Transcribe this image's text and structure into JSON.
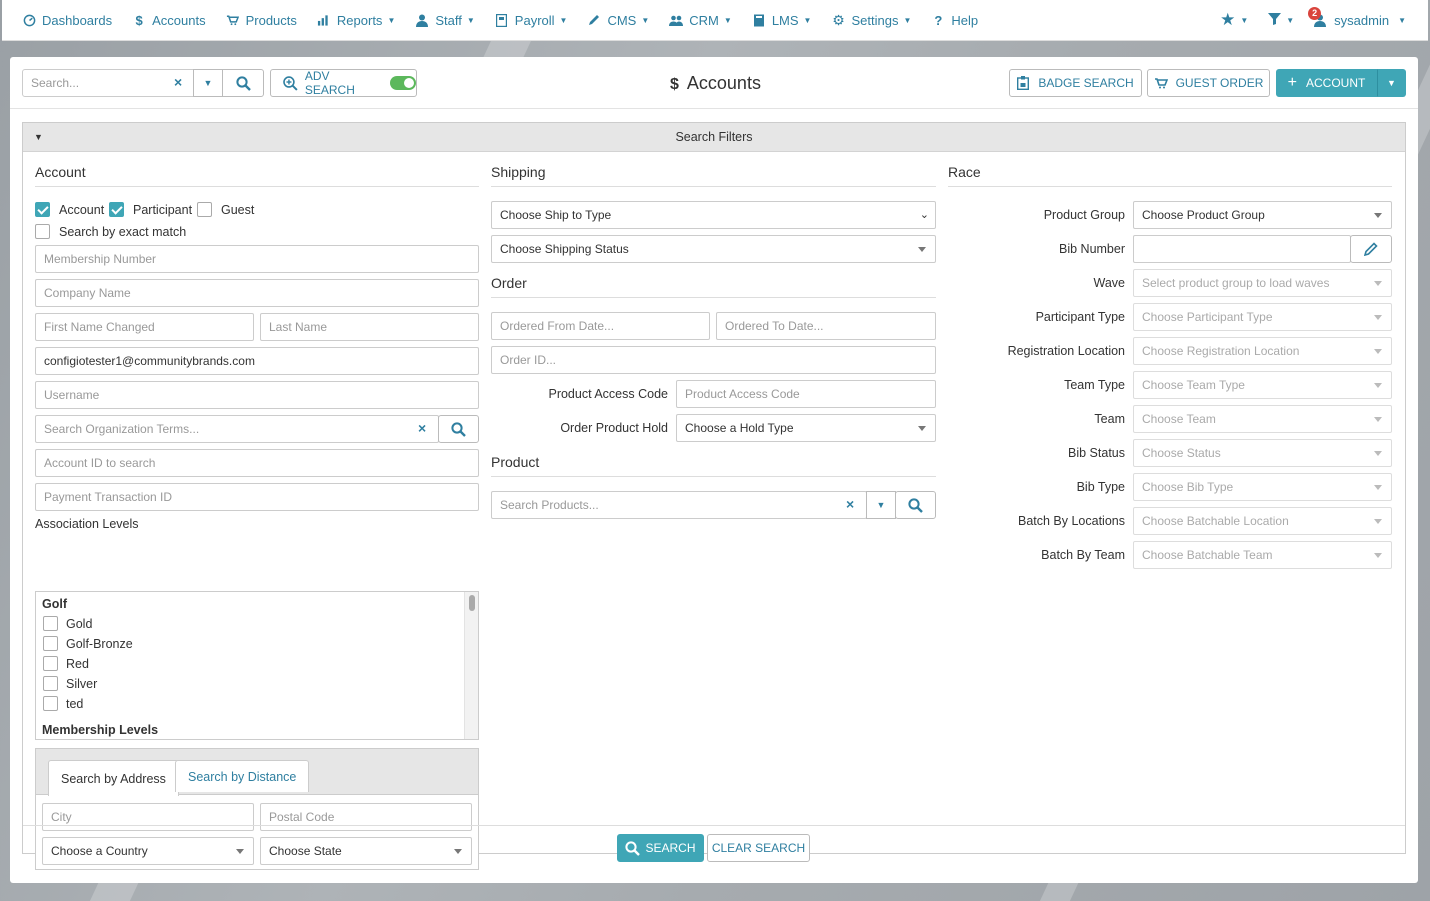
{
  "nav": {
    "items": [
      {
        "label": "Dashboards",
        "icon": "dashboard-icon"
      },
      {
        "label": "Accounts",
        "icon": "dollar-icon"
      },
      {
        "label": "Products",
        "icon": "cart-icon"
      },
      {
        "label": "Reports",
        "icon": "chart-icon"
      },
      {
        "label": "Staff",
        "icon": "person-icon"
      },
      {
        "label": "Payroll",
        "icon": "ledger-icon"
      },
      {
        "label": "CMS",
        "icon": "pencil-icon"
      },
      {
        "label": "CRM",
        "icon": "people-icon"
      },
      {
        "label": "LMS",
        "icon": "book-icon"
      },
      {
        "label": "Settings",
        "icon": "gear-icon"
      },
      {
        "label": "Help",
        "icon": "question-icon"
      }
    ],
    "notification_count": "2",
    "user": "sysadmin"
  },
  "toolbar": {
    "search_placeholder": "Search...",
    "adv_search_label": "ADV SEARCH",
    "page_title": "Accounts",
    "badge_search_label": "BADGE SEARCH",
    "guest_order_label": "GUEST ORDER",
    "add_account_label": "ACCOUNT"
  },
  "filters": {
    "title": "Search Filters",
    "account": {
      "heading": "Account",
      "cb_account": "Account",
      "cb_participant": "Participant",
      "cb_guest": "Guest",
      "cb_exact": "Search by exact match",
      "membership_number": "Membership Number",
      "company_name": "Company Name",
      "first_name": "First Name Changed",
      "last_name": "Last Name",
      "email_value": "configiotester1@communitybrands.com",
      "username": "Username",
      "org_terms": "Search Organization Terms...",
      "account_id": "Account ID to search",
      "payment_txn": "Payment Transaction ID",
      "assoc_levels_label": "Association Levels",
      "assoc_group_golf": "Golf",
      "assoc_items": [
        "Gold",
        "Golf-Bronze",
        "Red",
        "Silver",
        "ted"
      ],
      "assoc_group_membership": "Membership Levels",
      "tab_address": "Search by Address",
      "tab_distance": "Search by Distance",
      "city": "City",
      "postal_code": "Postal Code",
      "country": "Choose a Country",
      "state": "Choose State"
    },
    "shipping": {
      "heading": "Shipping",
      "ship_to_type": "Choose Ship to Type",
      "shipping_status": "Choose Shipping Status"
    },
    "order": {
      "heading": "Order",
      "from_date": "Ordered From Date...",
      "to_date": "Ordered To Date...",
      "order_id": "Order ID...",
      "access_code_label": "Product Access Code",
      "access_code_placeholder": "Product Access Code",
      "hold_label": "Order Product Hold",
      "hold_value": "Choose a Hold Type"
    },
    "product": {
      "heading": "Product",
      "search_placeholder": "Search Products..."
    },
    "race": {
      "heading": "Race",
      "product_group_label": "Product Group",
      "product_group_value": "Choose Product Group",
      "bib_number_label": "Bib Number",
      "wave_label": "Wave",
      "wave_value": "Select product group to load waves",
      "participant_type_label": "Participant Type",
      "participant_type_value": "Choose Participant Type",
      "reg_location_label": "Registration Location",
      "reg_location_value": "Choose Registration Location",
      "team_type_label": "Team Type",
      "team_type_value": "Choose Team Type",
      "team_label": "Team",
      "team_value": "Choose Team",
      "bib_status_label": "Bib Status",
      "bib_status_value": "Choose Status",
      "bib_type_label": "Bib Type",
      "bib_type_value": "Choose Bib Type",
      "batch_locations_label": "Batch By Locations",
      "batch_locations_value": "Choose Batchable Location",
      "batch_team_label": "Batch By Team",
      "batch_team_value": "Choose Batchable Team"
    },
    "search_button": "SEARCH",
    "clear_button": "CLEAR SEARCH"
  },
  "colors": {
    "accent": "#3fa6b6",
    "link": "#2f7fa0",
    "badge": "#d9443d"
  }
}
